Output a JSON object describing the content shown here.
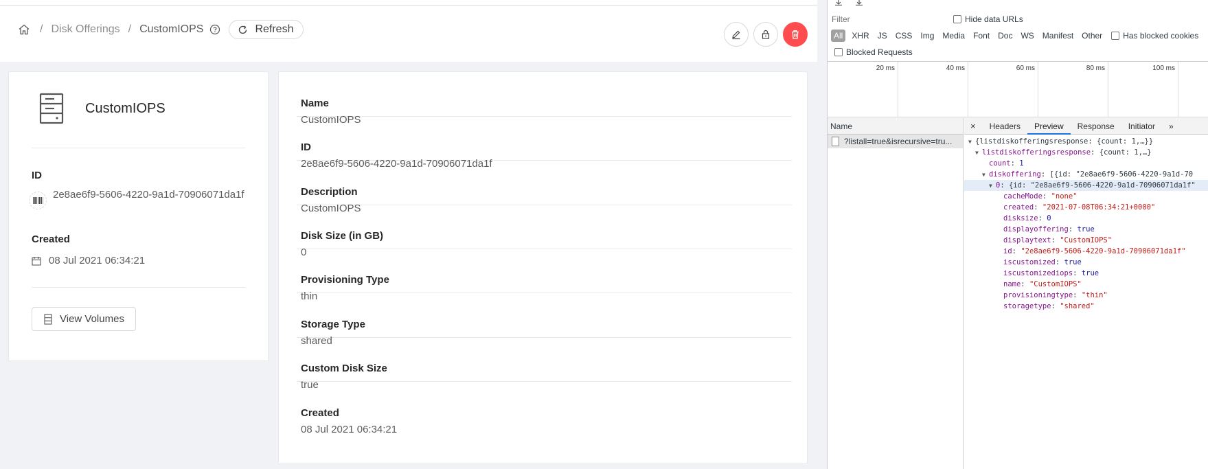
{
  "breadcrumb": {
    "parent": "Disk Offerings",
    "separator": "/",
    "current": "CustomIOPS"
  },
  "header": {
    "refresh_label": "Refresh"
  },
  "resource": {
    "name": "CustomIOPS",
    "id_label": "ID",
    "id": "2e8ae6f9-5606-4220-9a1d-70906071da1f",
    "created_label": "Created",
    "created": "08 Jul 2021 06:34:21",
    "view_volumes_label": "View Volumes"
  },
  "details": [
    {
      "label": "Name",
      "value": "CustomIOPS"
    },
    {
      "label": "ID",
      "value": "2e8ae6f9-5606-4220-9a1d-70906071da1f"
    },
    {
      "label": "Description",
      "value": "CustomIOPS"
    },
    {
      "label": "Disk Size (in GB)",
      "value": "0"
    },
    {
      "label": "Provisioning Type",
      "value": "thin"
    },
    {
      "label": "Storage Type",
      "value": "shared"
    },
    {
      "label": "Custom Disk Size",
      "value": "true"
    },
    {
      "label": "Created",
      "value": "08 Jul 2021 06:34:21"
    }
  ],
  "devtools": {
    "filter_placeholder": "Filter",
    "hide_data_urls": "Hide data URLs",
    "types": [
      "All",
      "XHR",
      "JS",
      "CSS",
      "Img",
      "Media",
      "Font",
      "Doc",
      "WS",
      "Manifest",
      "Other"
    ],
    "has_blocked_cookies": "Has blocked cookies",
    "blocked_requests": "Blocked Requests",
    "timeline_ticks": [
      "20 ms",
      "40 ms",
      "60 ms",
      "80 ms",
      "100 ms"
    ],
    "name_header": "Name",
    "request_name": "?listall=true&isrecursive=tru...",
    "tabs": [
      "Headers",
      "Preview",
      "Response",
      "Initiator"
    ],
    "active_tab": "Preview",
    "more_tabs": "»",
    "close": "×",
    "json_root": "{listdiskofferingsresponse: {count: 1,…}}",
    "json_level1_key": "listdiskofferingsresponse",
    "json_level1_val": "{count: 1,…}",
    "json_count_key": "count",
    "json_count_val": "1",
    "json_diskoffering_key": "diskoffering",
    "json_diskoffering_val": "[{id: \"2e8ae6f9-5606-4220-9a1d-70",
    "json_item0_key": "0",
    "json_item0_val": "{id: \"2e8ae6f9-5606-4220-9a1d-70906071da1f\"",
    "json_fields": [
      {
        "key": "cacheMode",
        "val": "\"none\"",
        "kind": "s"
      },
      {
        "key": "created",
        "val": "\"2021-07-08T06:34:21+0000\"",
        "kind": "s"
      },
      {
        "key": "disksize",
        "val": "0",
        "kind": "n"
      },
      {
        "key": "displayoffering",
        "val": "true",
        "kind": "b"
      },
      {
        "key": "displaytext",
        "val": "\"CustomIOPS\"",
        "kind": "s"
      },
      {
        "key": "id",
        "val": "\"2e8ae6f9-5606-4220-9a1d-70906071da1f\"",
        "kind": "s"
      },
      {
        "key": "iscustomized",
        "val": "true",
        "kind": "b"
      },
      {
        "key": "iscustomizediops",
        "val": "true",
        "kind": "b"
      },
      {
        "key": "name",
        "val": "\"CustomIOPS\"",
        "kind": "s"
      },
      {
        "key": "provisioningtype",
        "val": "\"thin\"",
        "kind": "s"
      },
      {
        "key": "storagetype",
        "val": "\"shared\"",
        "kind": "s"
      }
    ]
  },
  "colors": {
    "danger": "#ff4d4f",
    "devtools_accent": "#1a73e8"
  }
}
